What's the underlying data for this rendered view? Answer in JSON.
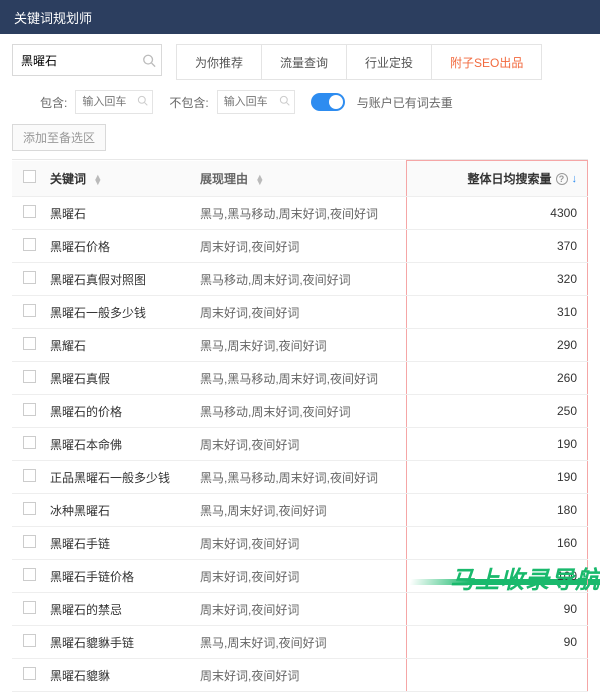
{
  "header": {
    "title": "关键词规划师"
  },
  "search": {
    "value": "黑曜石"
  },
  "tabs": [
    {
      "label": "为你推荐"
    },
    {
      "label": "流量查询"
    },
    {
      "label": "行业定投"
    },
    {
      "label": "附子SEO出品",
      "brand": true
    }
  ],
  "filters": {
    "include_label": "包含:",
    "exclude_label": "不包含:",
    "placeholder": "输入回车",
    "toggle_label": "与账户已有词去重"
  },
  "add_button": "添加至备选区",
  "columns": {
    "keyword": "关键词",
    "reason": "展现理由",
    "volume": "整体日均搜索量"
  },
  "rows": [
    {
      "keyword": "黑曜石",
      "reason": "黑马,黑马移动,周末好词,夜间好词",
      "volume": "4300"
    },
    {
      "keyword": "黑曜石价格",
      "reason": "周末好词,夜间好词",
      "volume": "370"
    },
    {
      "keyword": "黑曜石真假对照图",
      "reason": "黑马移动,周末好词,夜间好词",
      "volume": "320"
    },
    {
      "keyword": "黑曜石一般多少钱",
      "reason": "周末好词,夜间好词",
      "volume": "310"
    },
    {
      "keyword": "黑耀石",
      "reason": "黑马,周末好词,夜间好词",
      "volume": "290"
    },
    {
      "keyword": "黑曜石真假",
      "reason": "黑马,黑马移动,周末好词,夜间好词",
      "volume": "260"
    },
    {
      "keyword": "黑曜石的价格",
      "reason": "黑马移动,周末好词,夜间好词",
      "volume": "250"
    },
    {
      "keyword": "黑曜石本命佛",
      "reason": "周末好词,夜间好词",
      "volume": "190"
    },
    {
      "keyword": "正品黑曜石一般多少钱",
      "reason": "黑马,黑马移动,周末好词,夜间好词",
      "volume": "190"
    },
    {
      "keyword": "冰种黑曜石",
      "reason": "黑马,周末好词,夜间好词",
      "volume": "180"
    },
    {
      "keyword": "黑曜石手链",
      "reason": "周末好词,夜间好词",
      "volume": "160"
    },
    {
      "keyword": "黑曜石手链价格",
      "reason": "周末好词,夜间好词",
      "volume": "100"
    },
    {
      "keyword": "黑曜石的禁忌",
      "reason": "周末好词,夜间好词",
      "volume": "90"
    },
    {
      "keyword": "黑曜石貔貅手链",
      "reason": "黑马,周末好词,夜间好词",
      "volume": "90"
    },
    {
      "keyword": "黑曜石貔貅",
      "reason": "周末好词,夜间好词",
      "volume": ""
    }
  ],
  "watermark": "马上收录导航"
}
